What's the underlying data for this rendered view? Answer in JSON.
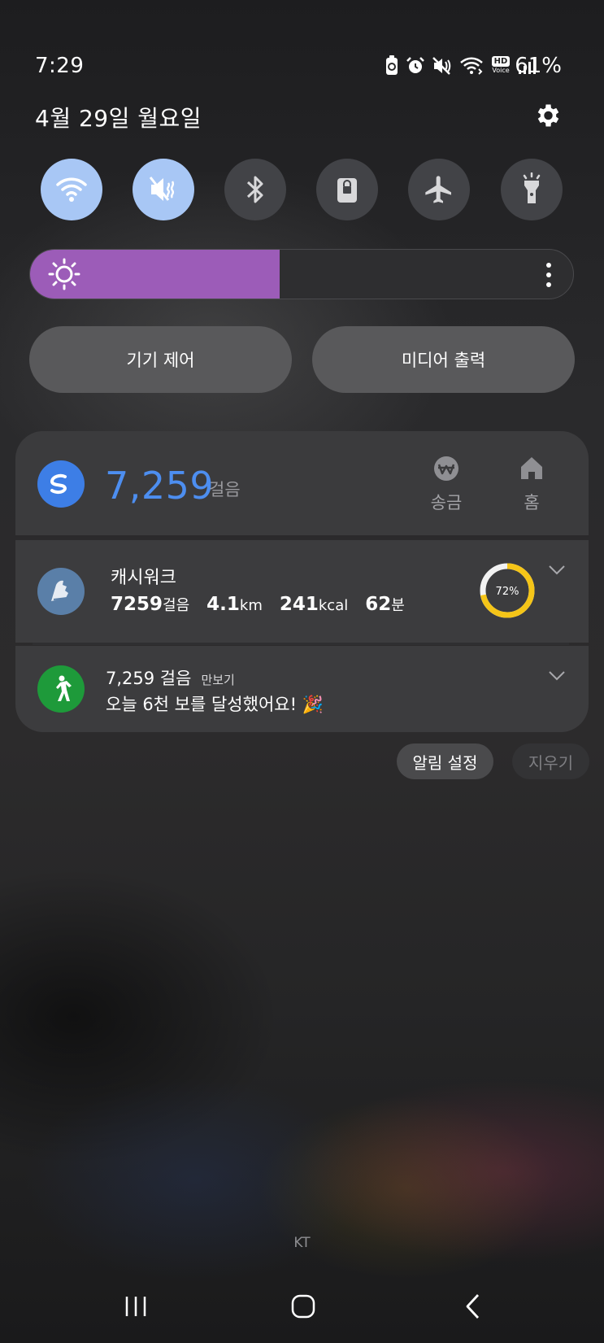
{
  "status_bar": {
    "time": "7:29",
    "battery_percent": "61%",
    "icons": [
      "battery-saver-icon",
      "alarm-icon",
      "mute-icon",
      "wifi-calling-icon",
      "hd-voice-icon",
      "signal-icon"
    ],
    "hd_label": "HD",
    "voice_label": "Voice"
  },
  "header": {
    "date": "4월 29일 월요일",
    "settings_icon": "gear-icon"
  },
  "quick_toggles": [
    {
      "name": "wifi",
      "icon": "wifi-icon",
      "on": true
    },
    {
      "name": "sound",
      "icon": "mute-icon",
      "on": true
    },
    {
      "name": "bluetooth",
      "icon": "bluetooth-icon",
      "on": false
    },
    {
      "name": "rotation-lock",
      "icon": "lock-icon",
      "on": false
    },
    {
      "name": "airplane",
      "icon": "airplane-icon",
      "on": false
    },
    {
      "name": "flashlight",
      "icon": "flashlight-icon",
      "on": false
    }
  ],
  "brightness": {
    "level_percent": 46,
    "fill_color": "#9c5cb8"
  },
  "buttons": {
    "device_control": "기기 제어",
    "media_output": "미디어 출력"
  },
  "pay_card": {
    "steps": "7,259",
    "steps_unit": "걸음",
    "send_label": "송금",
    "home_label": "홈",
    "accent_color": "#4d8ef0"
  },
  "cashwalk": {
    "title": "캐시워크",
    "steps": "7259",
    "steps_unit": "걸음",
    "distance": "4.1",
    "distance_unit": "km",
    "calories": "241",
    "calories_unit": "kcal",
    "minutes": "62",
    "minutes_unit": "분",
    "progress_percent": 72,
    "progress_label": "72%",
    "ring_color": "#f5c518"
  },
  "pedometer": {
    "steps_text": "7,259 걸음",
    "app_name": "만보기",
    "message": "오늘 6천 보를 달성했어요! 🎉"
  },
  "notification_actions": {
    "settings": "알림 설정",
    "clear": "지우기"
  },
  "carrier": "KT",
  "navigation": [
    "recent-apps-icon",
    "home-icon",
    "back-icon"
  ]
}
